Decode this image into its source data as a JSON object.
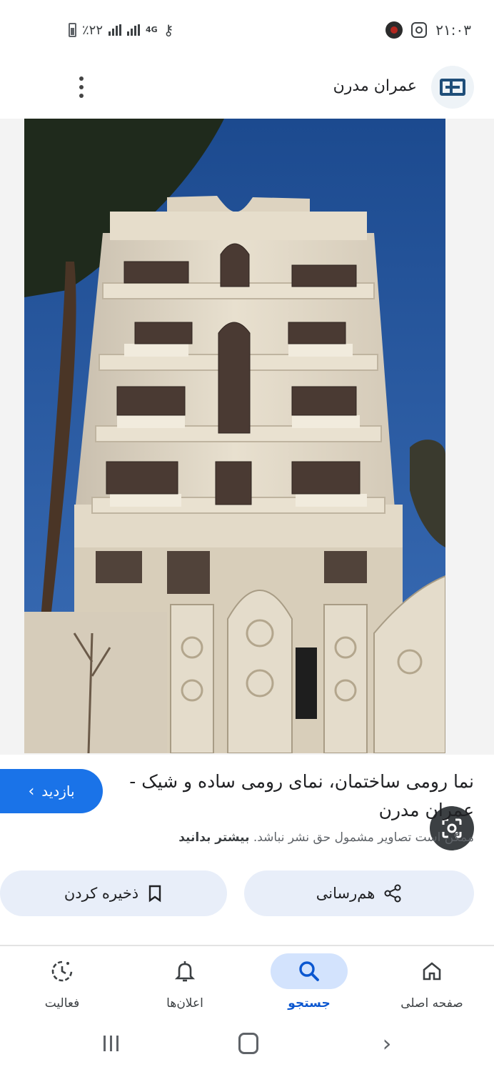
{
  "status_bar": {
    "time": "۲۱:۰۳",
    "battery": "٪۲۲",
    "network": "4G"
  },
  "header": {
    "site_name": "عمران مدرن",
    "more_icon": "more-vert-icon",
    "logo_icon": "site-logo-icon"
  },
  "image": {
    "description_icon": "lens-icon"
  },
  "caption": {
    "visit_label": "بازدید",
    "title": "نما رومی ساختمان، نمای رومی ساده و شیک - عمران مدرن",
    "copyright_text": "ممکن است تصاویر مشمول حق نشر نباشد.",
    "learn_more": "بیشتر بدانید"
  },
  "actions": {
    "share_label": "هم‌رسانی",
    "save_label": "ذخیره کردن"
  },
  "bottom_nav": {
    "items": [
      {
        "label": "صفحه اصلی",
        "icon": "home-icon"
      },
      {
        "label": "جستجو",
        "icon": "search-icon",
        "active": true
      },
      {
        "label": "اعلان‌ها",
        "icon": "bell-icon"
      },
      {
        "label": "فعالیت",
        "icon": "activity-icon"
      }
    ]
  },
  "colors": {
    "accent": "#1a73e8",
    "active_pill": "#d3e3fd",
    "pill_bg": "#e8eef9"
  }
}
